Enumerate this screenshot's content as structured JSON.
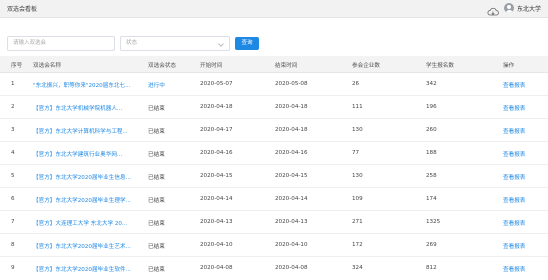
{
  "app": {
    "title": "双选会看板",
    "user_name": "东北大学"
  },
  "filters": {
    "name_placeholder": "请输入双选会",
    "status_placeholder": "状态",
    "query_label": "查询"
  },
  "table": {
    "headers": [
      "序号",
      "双选会名称",
      "双选会状态",
      "开始时间",
      "结束时间",
      "参会企业数",
      "学生报名数",
      "操作"
    ],
    "rows": [
      {
        "idx": "1",
        "name": "\"东北振兴，职等你来\"2020届东北七...",
        "state": "进行中",
        "start": "2020-05-07",
        "end": "2020-05-08",
        "companies": "26",
        "students": "342",
        "op": "查看报表"
      },
      {
        "idx": "2",
        "name": "【官方】东北大学机械学院机器人...",
        "state": "已结束",
        "start": "2020-04-18",
        "end": "2020-04-18",
        "companies": "111",
        "students": "196",
        "op": "查看报表"
      },
      {
        "idx": "3",
        "name": "【官方】东北大学计算机科学与工程...",
        "state": "已结束",
        "start": "2020-04-17",
        "end": "2020-04-18",
        "companies": "130",
        "students": "260",
        "op": "查看报表"
      },
      {
        "idx": "4",
        "name": "【官方】东北大学建筑行业奥华网...",
        "state": "已结束",
        "start": "2020-04-16",
        "end": "2020-04-16",
        "companies": "77",
        "students": "188",
        "op": "查看报表"
      },
      {
        "idx": "5",
        "name": "【官方】东北大学2020届毕业生信息...",
        "state": "已结束",
        "start": "2020-04-15",
        "end": "2020-04-15",
        "companies": "130",
        "students": "258",
        "op": "查看报表"
      },
      {
        "idx": "6",
        "name": "【官方】东北大学2020届毕业生理学...",
        "state": "已结束",
        "start": "2020-04-14",
        "end": "2020-04-14",
        "companies": "109",
        "students": "174",
        "op": "查看报表"
      },
      {
        "idx": "7",
        "name": "【官方】大连理工大学 东北大学 20...",
        "state": "已结束",
        "start": "2020-04-13",
        "end": "2020-04-13",
        "companies": "271",
        "students": "1325",
        "op": "查看报表"
      },
      {
        "idx": "8",
        "name": "【官方】东北大学2020届毕业生艺术...",
        "state": "已结束",
        "start": "2020-04-10",
        "end": "2020-04-10",
        "companies": "172",
        "students": "269",
        "op": "查看报表"
      },
      {
        "idx": "9",
        "name": "【官方】东北大学2020届毕业生软件...",
        "state": "已结束",
        "start": "2020-04-08",
        "end": "2020-04-08",
        "companies": "324",
        "students": "812",
        "op": "查看报表"
      }
    ]
  },
  "icons": {
    "cloud": "cloud-download-icon",
    "avatar": "user-avatar-icon"
  },
  "colors": {
    "accent": "#1e88e5",
    "header_bg": "#f2f2f2"
  }
}
